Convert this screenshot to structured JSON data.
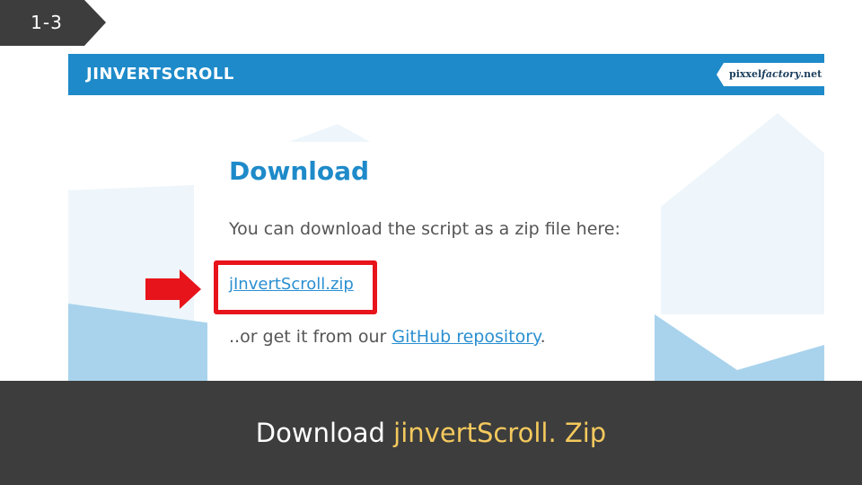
{
  "step": {
    "label": "1-3"
  },
  "site": {
    "logo": "JINVERTSCROLL",
    "badge_pre": "pixxel",
    "badge_em": "factory",
    "badge_post": ".net"
  },
  "download": {
    "title": "Download",
    "description": "You can download the script as a zip file here:",
    "zip_link": "jInvertScroll.zip",
    "alt_prefix": "..or get it from our ",
    "github_link": "GitHub repository",
    "alt_suffix": "."
  },
  "caption": {
    "prefix": "Download ",
    "highlight": "jinvertScroll. Zip"
  },
  "colors": {
    "header_blue": "#1e8ac9",
    "highlight_red": "#e8141b",
    "caption_bg": "#3d3d3d",
    "caption_accent": "#f4c95d"
  }
}
